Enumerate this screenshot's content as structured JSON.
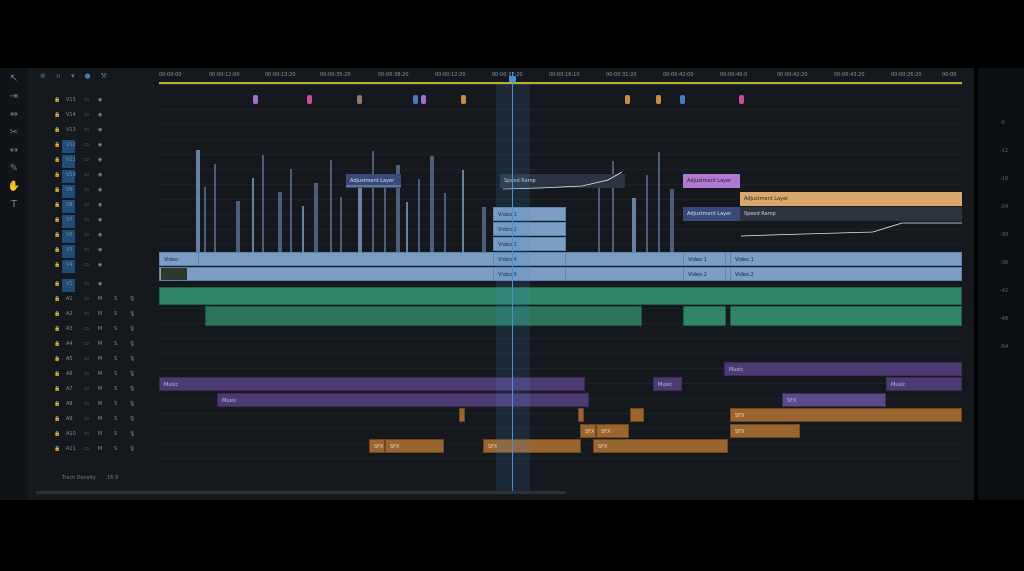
{
  "timecodes": [
    "00:00:00",
    "00:00:12:00",
    "00:00:13:20",
    "00:00:35:20",
    "00:00:38:20",
    "00:00:12:20",
    "00:00:37:20",
    "00:00:16:10",
    "00:00:31:20",
    "00:00:42:00",
    "00:00:40:0",
    "00:00:42:20",
    "00:00:43:20",
    "00:00:26:20",
    "00:00"
  ],
  "headers": [
    {
      "id": "V15",
      "row": 1
    },
    {
      "id": "V14",
      "row": 2
    },
    {
      "id": "V13",
      "row": 3
    },
    {
      "id": "V12",
      "row": 4
    },
    {
      "id": "V11",
      "row": 5
    },
    {
      "id": "V10",
      "row": 6
    },
    {
      "id": "V9",
      "row": 7
    },
    {
      "id": "V8",
      "row": 8
    },
    {
      "id": "V7",
      "row": 9
    },
    {
      "id": "V6",
      "row": 10
    },
    {
      "id": "V5",
      "row": 11
    },
    {
      "id": "V4",
      "row": 12
    },
    {
      "id": "V1",
      "row": 13
    },
    {
      "id": "A1",
      "row": 14
    },
    {
      "id": "A2",
      "row": 15
    },
    {
      "id": "A3",
      "row": 16
    },
    {
      "id": "A4",
      "row": 17
    },
    {
      "id": "A5",
      "row": 18
    },
    {
      "id": "A6",
      "row": 19
    },
    {
      "id": "A7",
      "row": 20
    },
    {
      "id": "A8",
      "row": 21
    },
    {
      "id": "A9",
      "row": 22
    },
    {
      "id": "A10",
      "row": 23
    },
    {
      "id": "A11",
      "row": 24
    }
  ],
  "audio_flags": [
    "M",
    "S"
  ],
  "footer": {
    "label": "Track Density",
    "value": "16.9"
  },
  "clips": {
    "adj1": "Adjustment Layer",
    "adj2": "Adjustment Layer",
    "adj3": "Adjustment Layer",
    "adj4": "Adjustment Layer",
    "sr1": "Speed Ramp",
    "sr2": "Speed Ramp",
    "v1": "Video 1",
    "v2": "Video 2",
    "v3": "Video 3",
    "v4": "Video 4",
    "v5": "Video 5",
    "v6": "Video 1",
    "v7": "Video 2",
    "v8": "Video 1",
    "v9": "Video 2",
    "vA": "Video",
    "m1": "Music",
    "m2": "Music",
    "m3": "Music",
    "m4": "Music",
    "m5": "Music",
    "s1": "SFX",
    "s2": "SFX",
    "s3": "SFX",
    "s4": "SFX",
    "s5": "SFX",
    "s6": "SFX",
    "s7": "SFX",
    "s8": "SFX",
    "s9": "SFX"
  },
  "meter_ticks": [
    "-6",
    "-12",
    "-18",
    "-24",
    "-30",
    "-36",
    "-42",
    "-48",
    "-54"
  ],
  "colors": {
    "playhead": "#4a8fd6",
    "marker_purple": "#a070d0",
    "marker_orange": "#d08a40",
    "marker_blue": "#4a78c8",
    "marker_pink": "#c8509a"
  }
}
